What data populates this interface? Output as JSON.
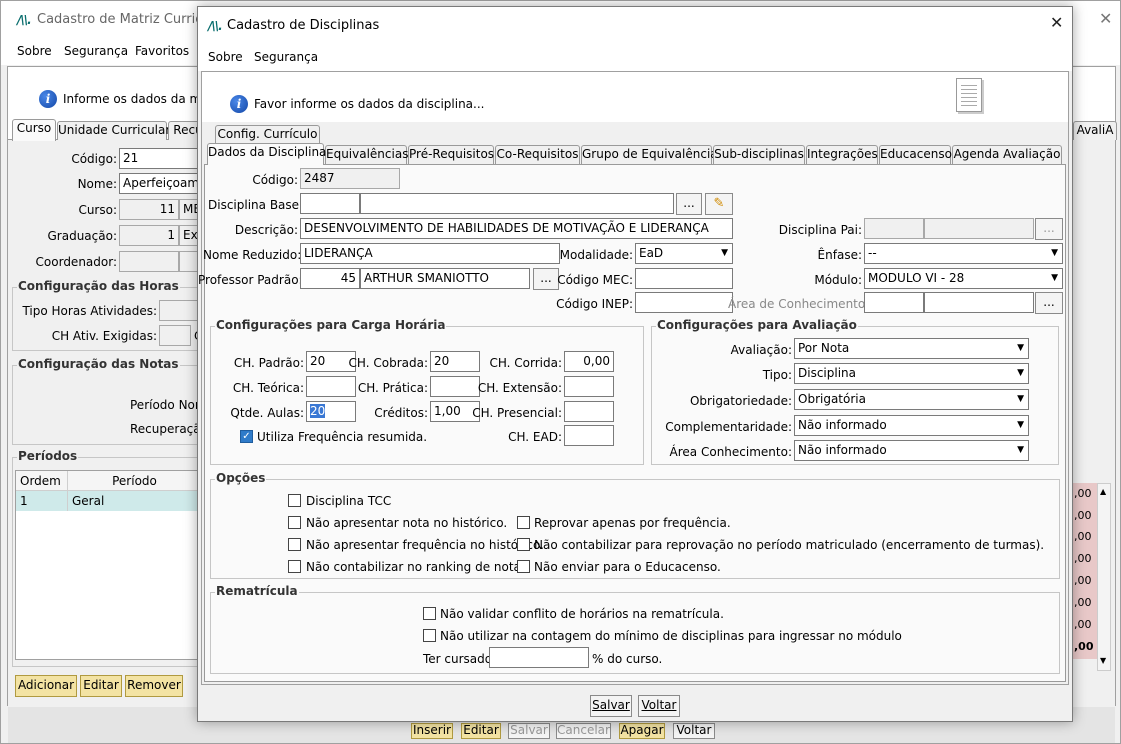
{
  "bg_window": {
    "title": "Cadastro de Matriz Curricular",
    "menu": [
      "Sobre",
      "Segurança",
      "Favoritos"
    ],
    "info": "Informe os dados da matr",
    "tabs": [
      "Curso",
      "Unidade Curricular",
      "Recu"
    ],
    "right_tab": "AvaliA",
    "fields": {
      "codigo_label": "Código:",
      "codigo_value": "21",
      "nome_label": "Nome:",
      "nome_value": "Aperfeiçoame",
      "curso_label": "Curso:",
      "curso_value": "11",
      "curso_value2": "ME",
      "graduacao_label": "Graduação:",
      "graduacao_value": "1",
      "graduacao_value2": "Ext",
      "coordenador_label": "Coordenador:"
    },
    "horas_group": "Configuração das Horas",
    "tipo_horas_label": "Tipo Horas Atividades:",
    "ch_ativ_label": "CH Ativ. Exigidas:",
    "ch_ativ_suffix": "C",
    "notas_group": "Configuração das Notas",
    "periodo_norm_label": "Período Norr",
    "recuperacao_label": "Recuperação",
    "periodos_group": "Períodos",
    "grid_headers": [
      "Ordem",
      "Período"
    ],
    "grid_rows": [
      {
        "ordem": "1",
        "periodo": "Geral"
      }
    ],
    "right_values": [
      ",00",
      ",00",
      ",00",
      ",00",
      ",00",
      ",00",
      ",00",
      ",00"
    ],
    "bottom_buttons": [
      "Adicionar",
      "Editar",
      "Remover"
    ],
    "footer_buttons": [
      "Inserir",
      "Editar",
      "Salvar",
      "Cancelar",
      "Apagar",
      "Voltar"
    ]
  },
  "dialog": {
    "title": "Cadastro de Disciplinas",
    "menu": [
      "Sobre",
      "Segurança"
    ],
    "info": "Favor informe os dados da disciplina...",
    "tabs_top": [
      "Config. Currículo"
    ],
    "tabs": [
      "Dados da Disciplina",
      "Equivalências",
      "Pré-Requisitos",
      "Co-Requisitos",
      "Grupo de Equivalência",
      "Sub-disciplinas",
      "Integrações",
      "Educacenso",
      "Agenda Avaliação"
    ],
    "codigo_label": "Código:",
    "codigo": "2487",
    "disciplina_base_label": "Disciplina Base:",
    "descricao_label": "Descrição:",
    "descricao": "DESENVOLVIMENTO DE HABILIDADES DE MOTIVAÇÃO E LIDERANÇA",
    "nome_reduzido_label": "Nome Reduzido:",
    "nome_reduzido": "LIDERANÇA",
    "modalidade_label": "Modalidade:",
    "modalidade": "EaD",
    "professor_label": "Professor Padrão:",
    "professor_id": "45",
    "professor_nome": "ARTHUR SMANIOTTO",
    "codigo_mec_label": "Código MEC:",
    "codigo_inep_label": "Código INEP:",
    "disciplina_pai_label": "Disciplina Pai:",
    "enfase_label": "Ênfase:",
    "enfase": "--",
    "modulo_label": "Módulo:",
    "modulo": "MODULO VI - 28",
    "area_conhecimento_label": "Área de Conhecimento:",
    "ellipsis": "...",
    "carga_group": "Configurações para Carga Horária",
    "ch_padrao_label": "CH. Padrão:",
    "ch_padrao": "20",
    "ch_cobrada_label": "CH. Cobrada:",
    "ch_cobrada": "20",
    "ch_corrida_label": "CH. Corrida:",
    "ch_corrida": "0,00",
    "ch_teorica_label": "CH. Teórica:",
    "ch_pratica_label": "CH. Prática:",
    "ch_extensao_label": "CH. Extensão:",
    "qtde_aulas_label": "Qtde. Aulas:",
    "qtde_aulas": "20",
    "creditos_label": "Créditos:",
    "creditos": "1,00",
    "ch_presencial_label": "CH. Presencial:",
    "utiliza_freq_label": "Utiliza Frequência resumida.",
    "ch_ead_label": "CH. EAD:",
    "avaliacao_group": "Configurações para Avaliação",
    "avaliacao_label": "Avaliação:",
    "avaliacao": "Por Nota",
    "tipo_label": "Tipo:",
    "tipo": "Disciplina",
    "obrigatoriedade_label": "Obrigatoriedade:",
    "obrigatoriedade": "Obrigatória",
    "complementaridade_label": "Complementaridade:",
    "complementaridade": "Não informado",
    "area_label": "Área Conhecimento:",
    "area": "Não informado",
    "opcoes_group": "Opções",
    "opt_tcc": "Disciplina TCC",
    "opt_nota": "Não apresentar nota no histórico.",
    "opt_freq": "Não apresentar frequência no histórico.",
    "opt_ranking": "Não contabilizar no ranking de notas.",
    "opt_reprovar": "Reprovar apenas por frequência.",
    "opt_reprovacao": "Não contabilizar para reprovação no período matriculado (encerramento de turmas).",
    "opt_educacenso": "Não enviar para o Educacenso.",
    "rematricula_group": "Rematrícula",
    "rem_conflito": "Não validar conflito de horários na rematrícula.",
    "rem_contagem": "Não utilizar na contagem do mínimo de disciplinas para ingressar no módulo",
    "ter_cursado_label": "Ter cursado:",
    "ter_cursado_suffix": "% do curso.",
    "salvar": "Salvar",
    "voltar": "Voltar"
  }
}
